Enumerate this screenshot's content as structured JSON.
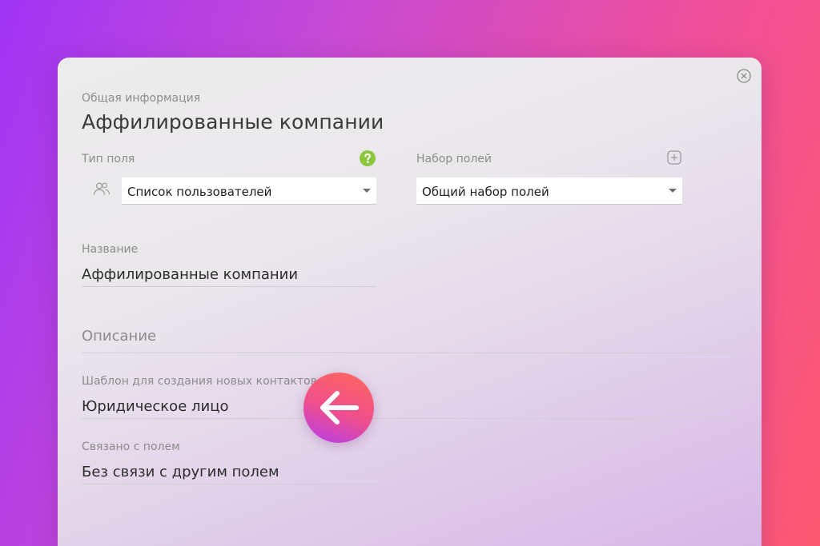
{
  "header": {
    "section_label": "Общая информация",
    "title": "Аффилированные компании"
  },
  "field_type": {
    "label": "Тип поля",
    "value": "Список пользователей",
    "help_icon": "question-icon",
    "type_icon": "users-icon"
  },
  "field_set": {
    "label": "Набор полей",
    "value": "Общий набор полей",
    "add_icon": "plus-square-icon"
  },
  "name": {
    "label": "Название",
    "value": "Аффилированные компании"
  },
  "description": {
    "placeholder": "Описание"
  },
  "template": {
    "label": "Шаблон для создания новых контактов",
    "value": "Юридическое лицо"
  },
  "linked": {
    "label": "Связано с полем",
    "value": "Без связи с другим полем"
  },
  "colors": {
    "help_green": "#8dc63f",
    "arrow_gradient_start": "#ff6a5c",
    "arrow_gradient_end": "#b43cf0"
  }
}
